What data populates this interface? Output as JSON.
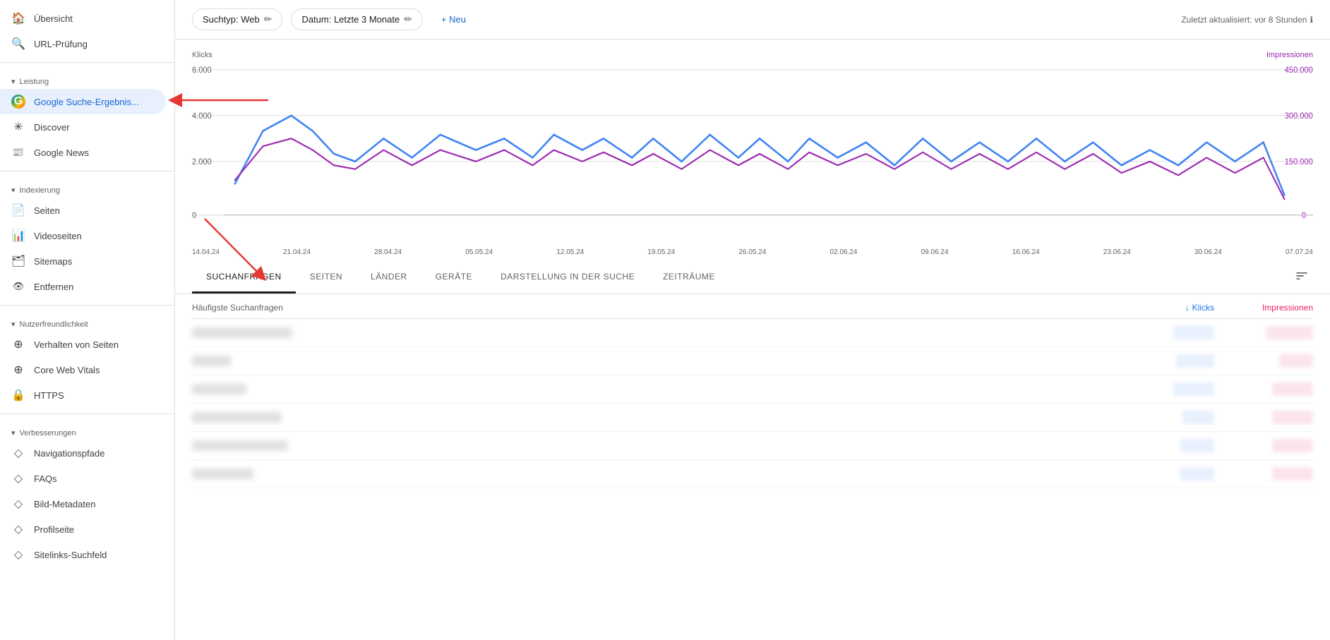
{
  "sidebar": {
    "items": [
      {
        "id": "uebersicht",
        "label": "Übersicht",
        "icon": "🏠",
        "active": false
      },
      {
        "id": "url-pruefung",
        "label": "URL-Prüfung",
        "icon": "🔍",
        "active": false
      }
    ],
    "sections": [
      {
        "label": "Leistung",
        "items": [
          {
            "id": "google-suche",
            "label": "Google Suche-Ergebnis...",
            "icon": "G",
            "active": true
          },
          {
            "id": "discover",
            "label": "Discover",
            "icon": "✳",
            "active": false
          },
          {
            "id": "google-news",
            "label": "Google News",
            "icon": "📰",
            "active": false
          }
        ]
      },
      {
        "label": "Indexierung",
        "items": [
          {
            "id": "seiten",
            "label": "Seiten",
            "icon": "📄",
            "active": false
          },
          {
            "id": "videoseiten",
            "label": "Videoseiten",
            "icon": "📊",
            "active": false
          },
          {
            "id": "sitemaps",
            "label": "Sitemaps",
            "icon": "🗂",
            "active": false
          },
          {
            "id": "entfernen",
            "label": "Entfernen",
            "icon": "👁",
            "active": false
          }
        ]
      },
      {
        "label": "Nutzerfreundlichkeit",
        "items": [
          {
            "id": "verhalten",
            "label": "Verhalten von Seiten",
            "icon": "⊕",
            "active": false
          },
          {
            "id": "core-web",
            "label": "Core Web Vitals",
            "icon": "⊕",
            "active": false
          },
          {
            "id": "https",
            "label": "HTTPS",
            "icon": "🔒",
            "active": false
          }
        ]
      },
      {
        "label": "Verbesserungen",
        "items": [
          {
            "id": "navigationspfade",
            "label": "Navigationspfade",
            "icon": "◇",
            "active": false
          },
          {
            "id": "faqs",
            "label": "FAQs",
            "icon": "◇",
            "active": false
          },
          {
            "id": "bild-metadaten",
            "label": "Bild-Metadaten",
            "icon": "◇",
            "active": false
          },
          {
            "id": "profilseite",
            "label": "Profilseite",
            "icon": "◇",
            "active": false
          },
          {
            "id": "sitelinks",
            "label": "Sitelinks-Suchfeld",
            "icon": "◇",
            "active": false
          }
        ]
      }
    ]
  },
  "topbar": {
    "filter1": "Suchtyp: Web",
    "filter2": "Datum: Letzte 3 Monate",
    "add_label": "+ Neu",
    "last_updated": "Zuletzt aktualisiert: vor 8 Stunden"
  },
  "chart": {
    "y_label_left": "Klicks",
    "y_label_right": "Impressionen",
    "y_max_left": "6.000",
    "y_mid_left": "4.000",
    "y_low_left": "2.000",
    "y_zero": "0",
    "y_max_right": "450.000",
    "y_mid_right": "300.000",
    "y_low_right": "150.000",
    "x_labels": [
      "14.04.24",
      "21.04.24",
      "28.04.24",
      "05.05.24",
      "12.05.24",
      "19.05.24",
      "26.05.24",
      "02.06.24",
      "09.06.24",
      "16.06.24",
      "23.06.24",
      "30.06.24",
      "07.07.24"
    ]
  },
  "tabs": {
    "items": [
      {
        "id": "suchanfragen",
        "label": "SUCHANFRAGEN",
        "active": true
      },
      {
        "id": "seiten",
        "label": "SEITEN",
        "active": false
      },
      {
        "id": "laender",
        "label": "LÄNDER",
        "active": false
      },
      {
        "id": "geraete",
        "label": "GERÄTE",
        "active": false
      },
      {
        "id": "darstellung",
        "label": "DARSTELLUNG IN DER SUCHE",
        "active": false
      },
      {
        "id": "zeitraeume",
        "label": "ZEITRÄUME",
        "active": false
      }
    ]
  },
  "table": {
    "col_query": "Häufigste Suchanfragen",
    "col_clicks": "Klicks",
    "col_impressions": "Impressionen",
    "rows": [
      {
        "query": "████ ███████",
        "clicks": "███ ██",
        "impressions": "███ ███"
      },
      {
        "query": "██████",
        "clicks": "█████",
        "impressions": "██ ██"
      },
      {
        "query": "███████ █",
        "clicks": "██ ███",
        "impressions": "██ ███"
      },
      {
        "query": "███ ████ ██████",
        "clicks": "████",
        "impressions": "██ ███"
      },
      {
        "query": "██████ ███ █████",
        "clicks": "█ ███",
        "impressions": "██ ███"
      },
      {
        "query": "██████ ███",
        "clicks": "█ ███",
        "impressions": "██ ███"
      }
    ]
  }
}
